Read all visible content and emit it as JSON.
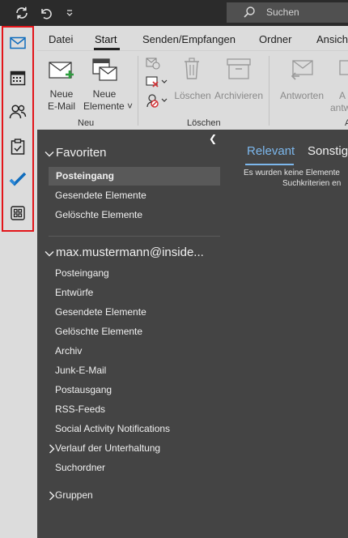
{
  "titlebar": {
    "search_placeholder": "Suchen"
  },
  "ribbon": {
    "tabs": [
      "Datei",
      "Start",
      "Senden/Empfangen",
      "Ordner",
      "Ansicht"
    ],
    "active_tab": "Start",
    "buttons": {
      "new_email_line1": "Neue",
      "new_email_line2": "E-Mail",
      "new_items_line1": "Neue",
      "new_items_line2": "Elemente ˅",
      "delete": "Löschen",
      "archive": "Archivieren",
      "reply": "Antworten",
      "reply_all_line1": "A",
      "reply_all_line2": "antw"
    },
    "groups": {
      "new": "Neu",
      "delete": "Löschen"
    }
  },
  "folders": {
    "favorites_header": "Favoriten",
    "favorites": [
      "Posteingang",
      "Gesendete Elemente",
      "Gelöschte Elemente"
    ],
    "account_header": "max.mustermann@inside...",
    "account_items": [
      "Posteingang",
      "Entwürfe",
      "Gesendete Elemente",
      "Gelöschte Elemente",
      "Archiv",
      "Junk-E-Mail",
      "Postausgang",
      "RSS-Feeds",
      "Social Activity Notifications",
      "Verlauf der Unterhaltung",
      "Suchordner"
    ],
    "groups_header": "Gruppen"
  },
  "message_list": {
    "tab_relevant": "Relevant",
    "tab_other": "Sonstige",
    "empty_line1": "Es wurden keine Elemente",
    "empty_line2": "Suchkriterien en"
  },
  "colors": {
    "highlight_border": "#e3151a",
    "accent_blue": "#0f6cbd",
    "selected_tab": "#7cb7ec"
  }
}
